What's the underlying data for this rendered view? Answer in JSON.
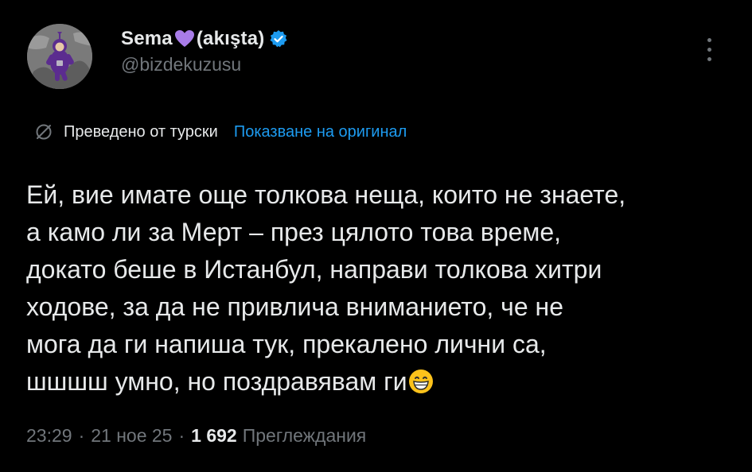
{
  "author": {
    "display_name": "Sema",
    "display_name_suffix": "(akışta)",
    "heart_icon": "purple-heart-icon",
    "verified_icon": "verified-badge-icon",
    "handle": "@bizdekuzusu",
    "avatar_icon": "purple-teletubby-avatar"
  },
  "translation": {
    "icon": "translate-icon",
    "label": "Преведено от турски",
    "show_original": "Показване на оригинал"
  },
  "tweet": {
    "text": "Ей, вие имате още толкова неща, които не знаете,\nа камо ли за Мерт – през цялото това време,\nдокато беше в Истанбул, направи толкова хитри\nходове, за да не привлича вниманието, че не\nмога да ги напиша тук, прекалено лични са,\nшшшш умно, но поздравявам ги",
    "emoji": "grinning-face-emoji"
  },
  "meta": {
    "time": "23:29",
    "date": "21 ное 25",
    "views_count": "1 692",
    "views_label": "Преглеждания",
    "separator": "·"
  },
  "colors": {
    "background": "#000000",
    "text": "#e7e9ea",
    "muted": "#71767b",
    "link": "#1d9bf0",
    "heart": "#a87ce8"
  }
}
